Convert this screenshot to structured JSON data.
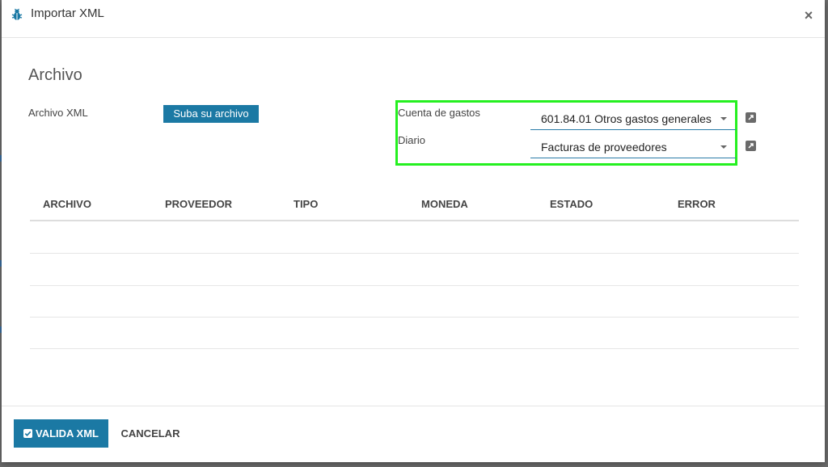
{
  "dialog": {
    "title": "Importar XML",
    "close_symbol": "×",
    "icon": "bug-icon"
  },
  "form": {
    "section_title": "Archivo",
    "file_label": "Archivo XML",
    "upload_label": "Suba su archivo",
    "expense_account": {
      "label": "Cuenta de gastos",
      "value": "601.84.01 Otros gastos generales"
    },
    "journal": {
      "label": "Diario",
      "value": "Facturas de proveedores"
    },
    "highlight_color": "#25f020"
  },
  "table": {
    "columns": [
      "ARCHIVO",
      "PROVEEDOR",
      "TIPO",
      "MONEDA",
      "ESTADO",
      "ERROR"
    ],
    "rows": []
  },
  "footer": {
    "validate_label": "VALIDA XML",
    "cancel_label": "CANCELAR"
  },
  "colors": {
    "primary": "#1b79a4",
    "field_underline": "#2a7ca8"
  }
}
